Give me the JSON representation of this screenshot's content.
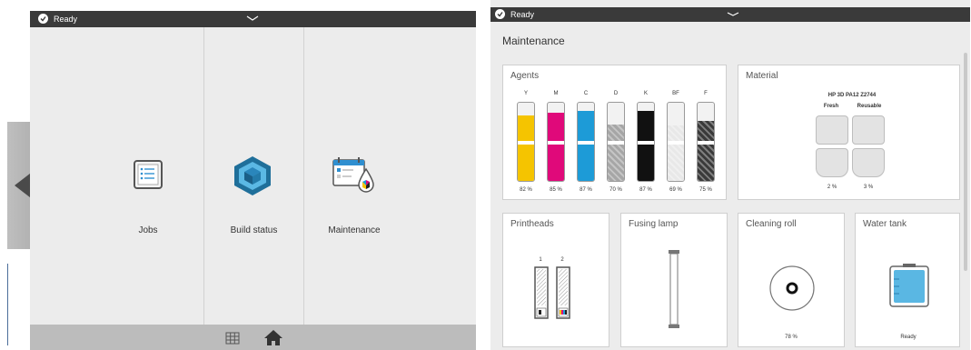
{
  "left": {
    "status": "Ready",
    "tiles": [
      {
        "label": "Jobs",
        "icon": "jobs-list-icon"
      },
      {
        "label": "Build status",
        "icon": "build-cube-icon"
      },
      {
        "label": "Maintenance",
        "icon": "maintenance-calendar-icon"
      }
    ],
    "bottom_icons": [
      "grid-icon",
      "home-icon"
    ]
  },
  "right": {
    "status": "Ready",
    "title": "Maintenance",
    "agents": {
      "title": "Agents",
      "items": [
        {
          "letter": "Y",
          "pct": "82 %",
          "color": "#f5c400"
        },
        {
          "letter": "M",
          "pct": "85 %",
          "color": "#e0097a"
        },
        {
          "letter": "C",
          "pct": "87 %",
          "color": "#1d9bd7"
        },
        {
          "letter": "D",
          "pct": "70 %",
          "color": "#a6a6a6"
        },
        {
          "letter": "K",
          "pct": "87 %",
          "color": "#111111"
        },
        {
          "letter": "BF",
          "pct": "69 %",
          "color": "#e8e8e8"
        },
        {
          "letter": "F",
          "pct": "75 %",
          "color": "#3a3a3a"
        }
      ]
    },
    "material": {
      "title": "Material",
      "name": "HP 3D PA12 Z2744",
      "fresh_label": "Fresh",
      "reusable_label": "Reusable",
      "fresh_pct": "2 %",
      "reusable_pct": "3 %"
    },
    "printheads": {
      "title": "Printheads",
      "labels": [
        "1",
        "2"
      ]
    },
    "fusing_lamp": {
      "title": "Fusing lamp"
    },
    "cleaning_roll": {
      "title": "Cleaning roll",
      "pct": "78 %"
    },
    "water_tank": {
      "title": "Water tank",
      "status": "Ready"
    }
  }
}
